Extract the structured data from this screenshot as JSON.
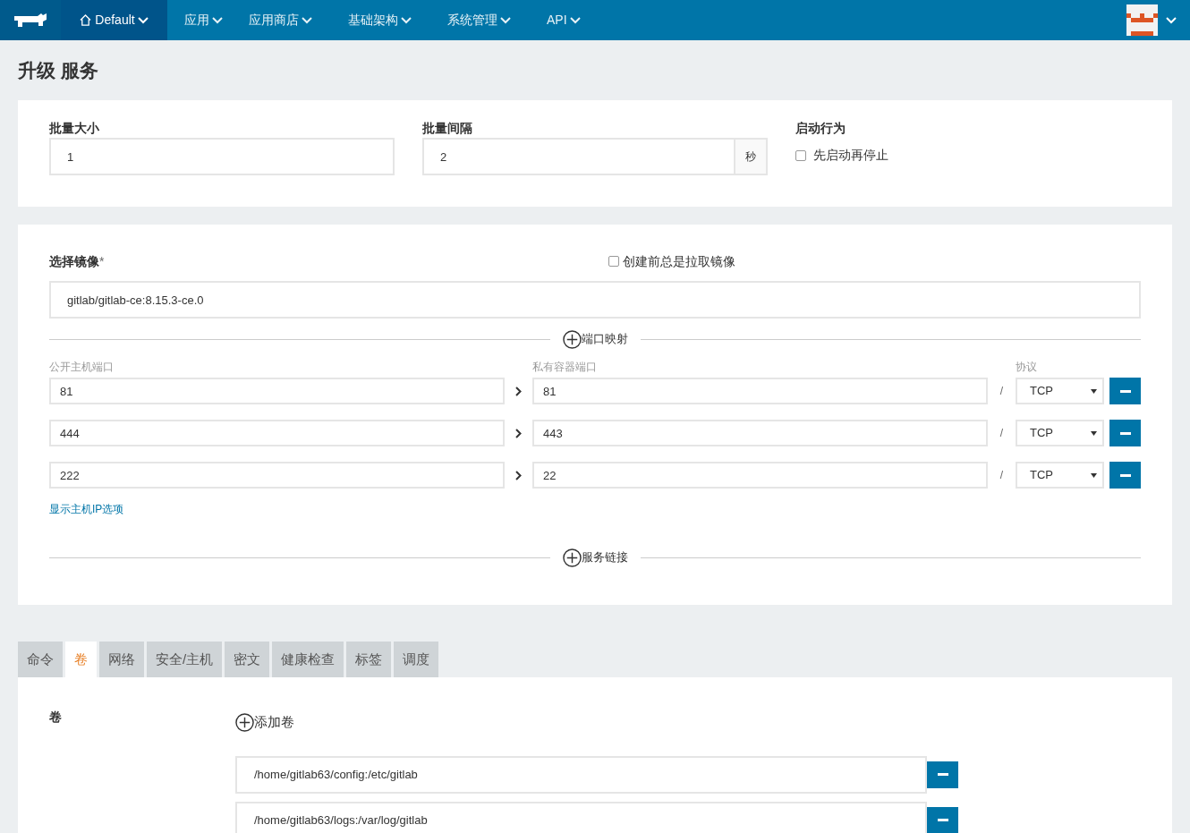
{
  "nav": {
    "environment": "Default",
    "menu": [
      {
        "label": "应用"
      },
      {
        "label": "应用商店"
      },
      {
        "label": "基础架构"
      },
      {
        "label": "系统管理"
      },
      {
        "label": "API"
      }
    ]
  },
  "page_title": "升级 服务",
  "batch": {
    "size": {
      "label": "批量大小",
      "value": "1"
    },
    "interval": {
      "label": "批量间隔",
      "value": "2",
      "unit": "秒"
    },
    "start_behavior": {
      "label": "启动行为",
      "option": "先启动再停止",
      "checked": false
    }
  },
  "image": {
    "label": "选择镜像",
    "required_mark": "*",
    "pull_always": {
      "label": "创建前总是拉取镜像",
      "checked": false
    },
    "value": "gitlab/gitlab-ce:8.15.3-ce.0"
  },
  "port_mapping": {
    "title": "端口映射",
    "columns": [
      "公开主机端口",
      "私有容器端口",
      "协议"
    ],
    "rows": [
      {
        "public": "81",
        "private": "81",
        "protocol": "TCP"
      },
      {
        "public": "444",
        "private": "443",
        "protocol": "TCP"
      },
      {
        "public": "222",
        "private": "22",
        "protocol": "TCP"
      }
    ],
    "separator": "/",
    "host_ip_link": "显示主机IP选项"
  },
  "service_links": {
    "title": "服务链接"
  },
  "tabs": [
    {
      "label": "命令",
      "selected": false
    },
    {
      "label": "卷",
      "selected": true
    },
    {
      "label": "网络",
      "selected": false
    },
    {
      "label": "安全/主机",
      "selected": false
    },
    {
      "label": "密文",
      "selected": false
    },
    {
      "label": "健康检查",
      "selected": false
    },
    {
      "label": "标签",
      "selected": false
    },
    {
      "label": "调度",
      "selected": false
    }
  ],
  "volumes": {
    "label": "卷",
    "add_label": "添加卷",
    "items": [
      "/home/gitlab63/config:/etc/gitlab",
      "/home/gitlab63/logs:/var/log/gitlab"
    ]
  }
}
